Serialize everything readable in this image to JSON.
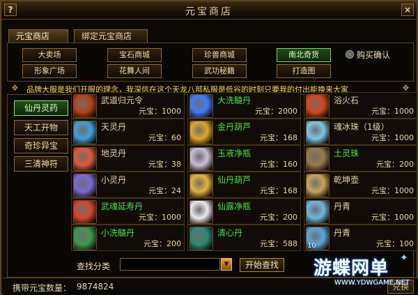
{
  "window": {
    "title": "元宝商店",
    "help_glyph": "?",
    "close_glyph": "×"
  },
  "tabs": [
    {
      "label": "元宝商店",
      "active": true
    },
    {
      "label": "绑定元宝商店",
      "active": false
    }
  ],
  "categories": [
    {
      "label": "大卖场",
      "active": false
    },
    {
      "label": "宝石商城",
      "active": false
    },
    {
      "label": "珍兽商城",
      "active": false
    },
    {
      "label": "南北奇货",
      "active": true
    },
    {
      "label": "形象广场",
      "active": false
    },
    {
      "label": "花舞人间",
      "active": false
    },
    {
      "label": "武功秘籍",
      "active": false
    },
    {
      "label": "打造图",
      "active": false
    }
  ],
  "purchase_confirm": {
    "label": "购买确认",
    "icon": "radio-icon"
  },
  "marquee": "品牌大服是我们开服的理念，我深信在这个天龙八部私服是低谷的时刻只要我的付出能换来大家",
  "subcategories": [
    {
      "label": "仙丹灵药",
      "active": true
    },
    {
      "label": "天工开物",
      "active": false
    },
    {
      "label": "奇珍异宝",
      "active": false
    },
    {
      "label": "三清神符",
      "active": false
    }
  ],
  "items": [
    {
      "name": "武道归元令",
      "price": "元宝：1000",
      "name_color": "#e8d7a8",
      "icon": "token-icon",
      "icon_color": "#b8421a"
    },
    {
      "name": "大洗髓丹",
      "price": "元宝：2000",
      "name_color": "#49e04a",
      "icon": "orb-icon",
      "icon_color": "#3c7bff"
    },
    {
      "name": "浴火石",
      "price": "元宝：1000",
      "name_color": "#e8d7a8",
      "icon": "fire-stone-icon",
      "icon_color": "#d8461a"
    },
    {
      "name": "天灵丹",
      "price": "元宝：60",
      "name_color": "#e8d7a8",
      "icon": "swirl-icon",
      "icon_color": "#3fa0e0"
    },
    {
      "name": "金丹葫芦",
      "price": "元宝：168",
      "name_color": "#49e04a",
      "icon": "gourd-icon",
      "icon_color": "#e0a82a"
    },
    {
      "name": "魂冰珠（1级）",
      "price": "元宝：1000",
      "name_color": "#e8d7a8",
      "icon": "ice-pearl-icon",
      "icon_color": "#78c8e8"
    },
    {
      "name": "地灵丹",
      "price": "元宝：38",
      "name_color": "#e8d7a8",
      "icon": "swirl-icon",
      "icon_color": "#e05a3a"
    },
    {
      "name": "玉液净瓶",
      "price": "元宝：160",
      "name_color": "#49e04a",
      "icon": "vase-icon",
      "icon_color": "#c9c0d8"
    },
    {
      "name": "土灵珠",
      "price": "元宝：200",
      "name_color": "#49e04a",
      "icon": "earth-pearl-icon",
      "icon_color": "#9a7a4a"
    },
    {
      "name": "小灵丹",
      "price": "元宝：24",
      "name_color": "#e8d7a8",
      "icon": "swirl-icon",
      "icon_color": "#7a6ad8"
    },
    {
      "name": "仙丹葫芦",
      "price": "元宝：168",
      "name_color": "#49e04a",
      "icon": "gourd-icon",
      "icon_color": "#e6b43a"
    },
    {
      "name": "乾坤壶",
      "price": "元宝：1000",
      "name_color": "#e8d7a8",
      "icon": "teapot-icon",
      "icon_color": "#caa45a"
    },
    {
      "name": "武魂延寿丹",
      "price": "元宝：1000",
      "name_color": "#49e04a",
      "icon": "elixir-icon",
      "icon_color": "#d8452a"
    },
    {
      "name": "仙露净瓶",
      "price": "元宝：200",
      "name_color": "#49e04a",
      "icon": "vase-icon",
      "icon_color": "#e8e8f0"
    },
    {
      "name": "丹青",
      "price": "元宝：1000",
      "name_color": "#e8d7a8",
      "icon": "painting-icon",
      "icon_color": "#6ab8e0"
    },
    {
      "name": "小洗髓丹",
      "price": "元宝：200",
      "name_color": "#49e04a",
      "icon": "box-icon",
      "icon_color": "#3a9a4a"
    },
    {
      "name": "清心丹",
      "price": "元宝：588",
      "name_color": "#49e04a",
      "icon": "box-icon",
      "icon_color": "#2a8a7a"
    },
    {
      "name": "丹青",
      "price": "元宝：100",
      "name_color": "#e8d7a8",
      "icon": "painting-icon",
      "icon_color": "#5aa8e0",
      "count": "10"
    }
  ],
  "search": {
    "label": "查找分类",
    "value": "",
    "button_label": "开始查找"
  },
  "footer": {
    "balance_label": "携带元宝数量：",
    "balance_value": "9874824",
    "exchange_label": "兑换"
  },
  "watermark": {
    "title": "游蝶网单",
    "url": "WWW.YDWGAME.NET"
  }
}
